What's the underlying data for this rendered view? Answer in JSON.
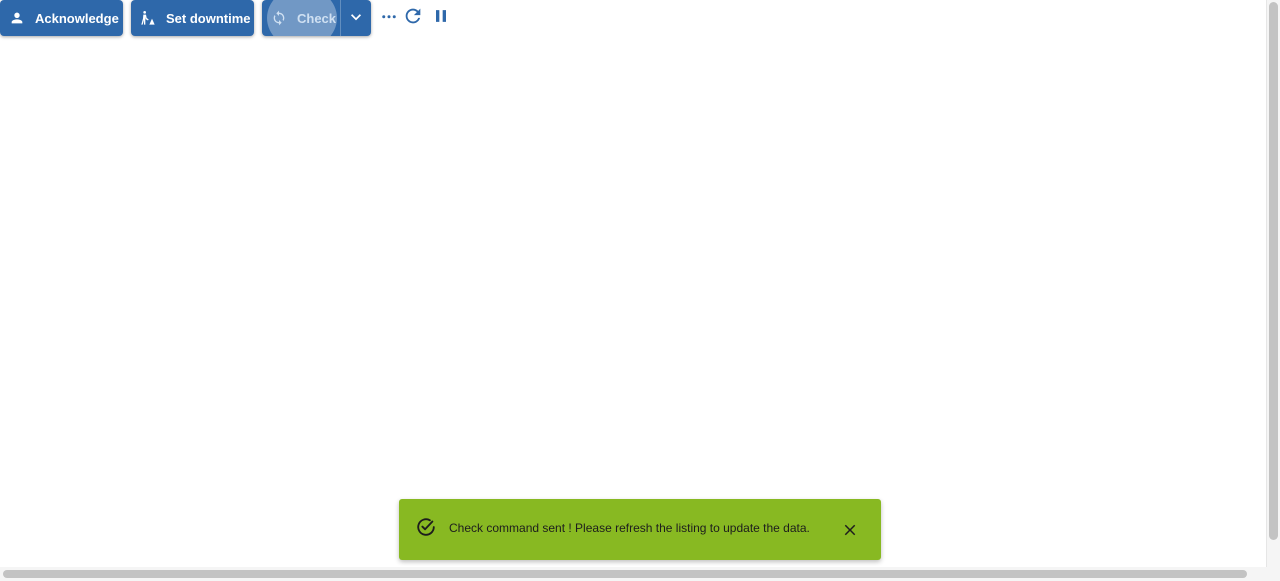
{
  "toolbar": {
    "acknowledge_label": "Acknowledge",
    "acknowledge_icon": "person-icon",
    "downtime_label": "Set downtime",
    "downtime_icon": "downtime-icon",
    "check_label": "Check",
    "check_icon": "sync-icon",
    "check_dropdown_icon": "chevron-down-icon",
    "more_icon": "more-horizontal-icon",
    "refresh_icon": "refresh-icon",
    "pause_icon": "pause-icon"
  },
  "snackbar": {
    "icon": "check-circle-icon",
    "message": "Check command sent ! Please refresh the listing to update the data.",
    "close_icon": "close-icon",
    "color": "#88b922"
  },
  "colors": {
    "primary": "#2e68aa",
    "success": "#88b922"
  }
}
